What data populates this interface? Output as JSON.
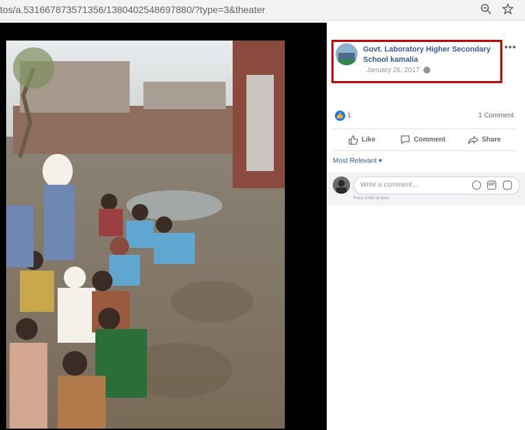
{
  "browser": {
    "url": "tos/a.531667873571356/1380402548697880/?type=3&theater",
    "zoom_icon": "zoom-out-icon",
    "bookmark_icon": "star-icon"
  },
  "post": {
    "page_name": "Govt. Laboratory Higher Secondary School kamalia",
    "date": "January 26, 2017 ·",
    "privacy_icon": "globe-icon",
    "more_icon": "more-icon"
  },
  "stats": {
    "likes": "1",
    "comments": "1 Comment"
  },
  "actions": {
    "like": "Like",
    "comment": "Comment",
    "share": "Share"
  },
  "comments": {
    "sort": "Most Relevant ▾",
    "placeholder": "Write a comment...",
    "hint": "Press Enter to post.",
    "gif_label": "GIF"
  },
  "colors": {
    "highlight": "#cc0000",
    "link": "#385898",
    "like_blue": "#1877f2"
  }
}
